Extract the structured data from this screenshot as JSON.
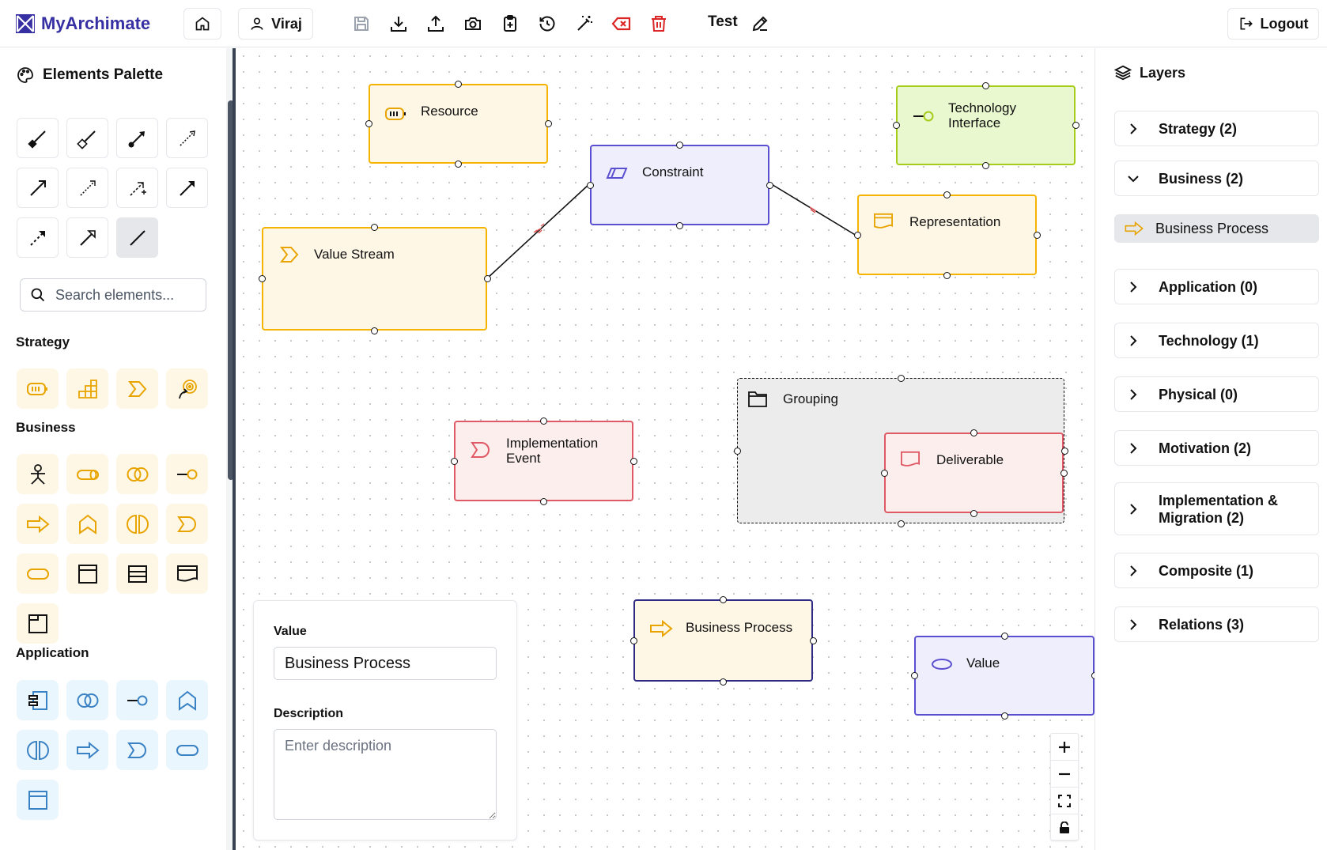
{
  "app": {
    "title": "MyArchimate",
    "user": "Viraj",
    "document_title": "Test",
    "logout_label": "Logout"
  },
  "toolbar": {
    "icons": [
      "home-icon",
      "user-icon",
      "save-icon",
      "download-icon",
      "upload-icon",
      "camera-icon",
      "clipboard-plus-icon",
      "history-icon",
      "magic-wand-icon",
      "clear-icon",
      "trash-icon",
      "pencil-icon"
    ]
  },
  "palette": {
    "title": "Elements Palette",
    "search_placeholder": "Search elements...",
    "sections": {
      "strategy": "Strategy",
      "business": "Business",
      "application": "Application"
    }
  },
  "canvas": {
    "nodes": {
      "resource": "Resource",
      "constraint": "Constraint",
      "technology_interface": "Technology Interface",
      "value_stream": "Value Stream",
      "representation": "Representation",
      "grouping": "Grouping",
      "implementation_event": "Implementation Event",
      "deliverable": "Deliverable",
      "business_process": "Business Process",
      "value": "Value"
    }
  },
  "properties": {
    "value_label": "Value",
    "value": "Business Process",
    "description_label": "Description",
    "description_placeholder": "Enter description"
  },
  "layers": {
    "title": "Layers",
    "items": [
      {
        "label": "Strategy (2)",
        "expanded": false
      },
      {
        "label": "Business (2)",
        "expanded": true
      },
      {
        "label": "Application (0)",
        "expanded": false
      },
      {
        "label": "Technology (1)",
        "expanded": false
      },
      {
        "label": "Physical (0)",
        "expanded": false
      },
      {
        "label": "Motivation (2)",
        "expanded": false
      },
      {
        "label": "Implementation & Migration (2)",
        "expanded": false
      },
      {
        "label": "Composite (1)",
        "expanded": false
      },
      {
        "label": "Relations (3)",
        "expanded": false
      }
    ],
    "business_child": "Business Process"
  },
  "colors": {
    "brand": "#3730a3",
    "business_fill": "#fef7e6",
    "business_stroke": "#f5b400",
    "motivation_fill": "#eeeefc",
    "motivation_stroke": "#5b4fd1",
    "technology_fill": "#eaf8cf",
    "technology_stroke": "#a6cc1c",
    "implementation_fill": "#fdeeee",
    "implementation_stroke": "#e05a66",
    "application_icon": "#3b82c4",
    "danger": "#dc2626"
  }
}
